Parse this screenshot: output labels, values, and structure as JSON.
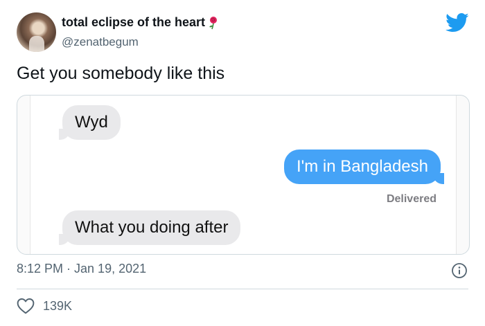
{
  "author": {
    "display_name": "total eclipse of the heart",
    "handle": "@zenatbegum",
    "avatar_icon": "avatar",
    "name_emoji_icon": "rose-icon"
  },
  "tweet": {
    "text": "Get you somebody like this",
    "timestamp": "8:12 PM · Jan 19, 2021",
    "likes": "139K"
  },
  "media": {
    "messages": [
      {
        "text": "Wyd",
        "direction": "incoming"
      },
      {
        "text": "I'm in Bangladesh",
        "direction": "outgoing"
      },
      {
        "text": "What you doing after",
        "direction": "incoming"
      }
    ],
    "delivered_label": "Delivered"
  },
  "icons": {
    "brand": "twitter-bird-icon",
    "info": "info-icon",
    "like": "heart-icon"
  },
  "colors": {
    "brand_blue": "#1d9bf0",
    "imessage_blue": "#45a3f7",
    "incoming_gray": "#e9e9eb",
    "secondary_text": "#536471"
  }
}
